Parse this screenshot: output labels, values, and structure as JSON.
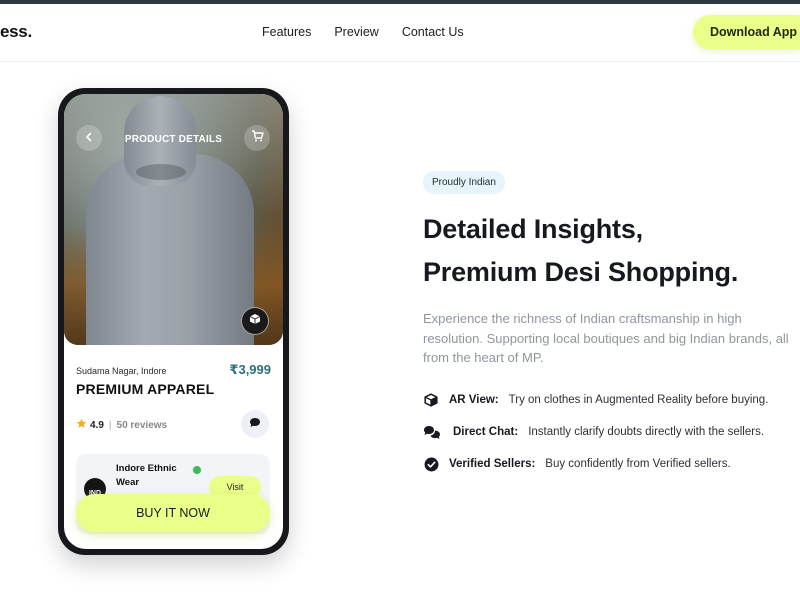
{
  "nav": {
    "logo": "ess.",
    "links": [
      "Features",
      "Preview",
      "Contact Us"
    ],
    "download_label": "Download App"
  },
  "phone": {
    "header_title": "PRODUCT DETAILS",
    "location": "Sudama Nagar, Indore",
    "price": "₹3,999",
    "product_name": "PREMIUM APPAREL",
    "rating": "4.9",
    "reviews": "50 reviews",
    "seller": {
      "name": "Indore Ethnic Wear",
      "avatar_text": "IND",
      "visit_label": "Visit"
    },
    "buy_label": "BUY IT NOW"
  },
  "hero": {
    "badge": "Proudly Indian",
    "headline_line1": "Detailed Insights,",
    "headline_line2": "Premium Desi Shopping.",
    "description": "Experience the richness of Indian craftsmanship in high resolution. Supporting local boutiques and big Indian brands, all from the heart of MP."
  },
  "features": [
    {
      "icon": "cube-icon",
      "title": "AR View:",
      "desc": "Try on clothes in Augmented Reality before buying."
    },
    {
      "icon": "chat-bubbles-icon",
      "title": "Direct Chat:",
      "desc": "Instantly clarify doubts directly with the sellers."
    },
    {
      "icon": "check-circle-icon",
      "title": "Verified Sellers:",
      "desc": "Buy confidently from Verified sellers."
    }
  ],
  "colors": {
    "accent": "#e9ff8a",
    "price": "#2d6f7a",
    "badge_bg": "#e8f4fb",
    "dark": "#16181c"
  }
}
